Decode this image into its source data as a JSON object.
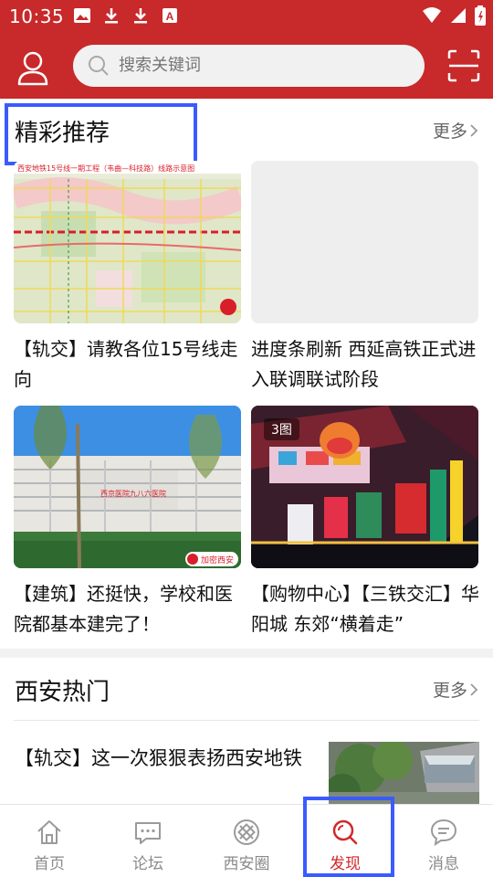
{
  "status_bar": {
    "time": "10:35"
  },
  "search": {
    "placeholder": "搜索关键词"
  },
  "featured": {
    "title": "精彩推荐",
    "more_label": "更多",
    "items": [
      {
        "caption": "【轨交】请教各位15号线走向",
        "image_text": "西安地铁15号线一期工程（韦曲—科技路）线路示意图",
        "image_count": ""
      },
      {
        "caption": "进度条刷新 西延高铁正式进入联调联试阶段",
        "image_text": "",
        "image_count": ""
      },
      {
        "caption": "【建筑】还挺快，学校和医院都基本建完了！",
        "image_text": "西京医院九八六医院",
        "watermark": "加密西安",
        "image_count": ""
      },
      {
        "caption": "【购物中心】【三铁交汇】华阳城 东郊“横着走”",
        "image_text": "",
        "image_count": "3图"
      }
    ]
  },
  "hot": {
    "title": "西安热门",
    "more_label": "更多",
    "items": [
      {
        "title": "【轨交】这一次狠狠表扬西安地铁"
      }
    ]
  },
  "bottom_nav": [
    {
      "label": "首页",
      "icon": "home-icon"
    },
    {
      "label": "论坛",
      "icon": "forum-icon"
    },
    {
      "label": "西安圈",
      "icon": "circle-icon"
    },
    {
      "label": "发现",
      "icon": "discover-icon",
      "active": true
    },
    {
      "label": "消息",
      "icon": "message-icon"
    }
  ],
  "colors": {
    "brand": "#c8292a",
    "highlight": "#3a5bff",
    "active": "#d2282a"
  }
}
